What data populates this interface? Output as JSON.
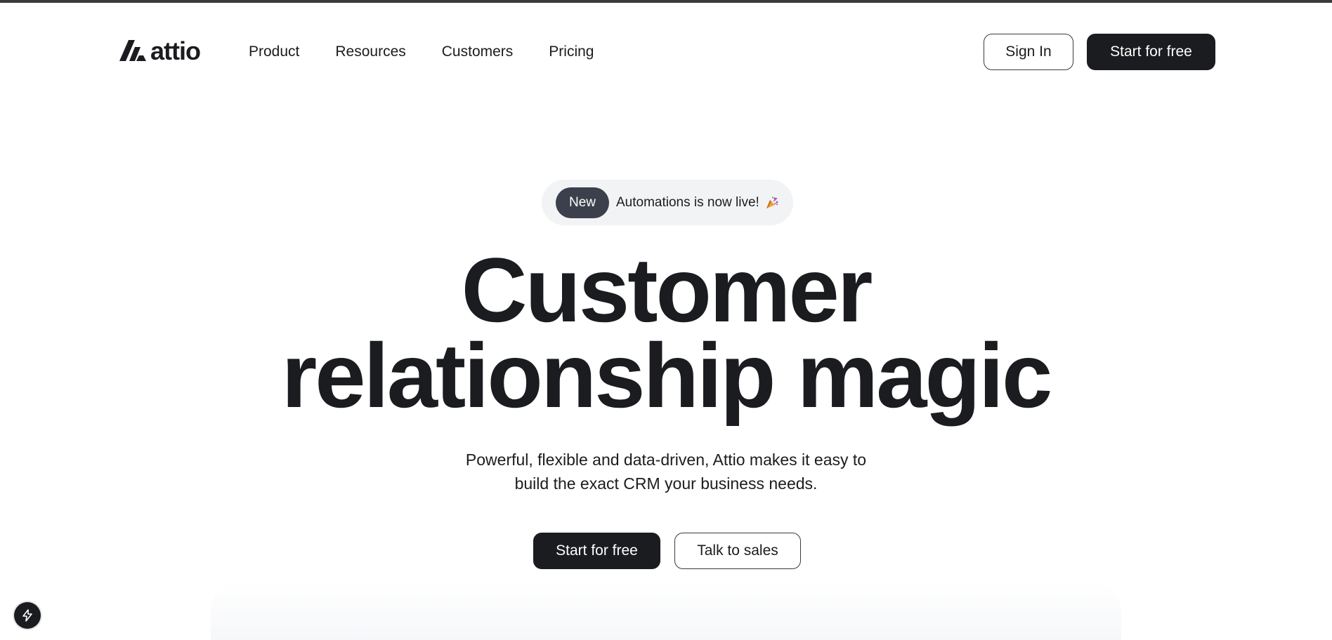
{
  "brand": {
    "name": "attio"
  },
  "nav": {
    "links": [
      "Product",
      "Resources",
      "Customers",
      "Pricing"
    ],
    "sign_in": "Sign In",
    "start_free": "Start for free"
  },
  "announcement": {
    "badge": "New",
    "text": "Automations is now live!",
    "emoji_icon": "party-popper-icon"
  },
  "hero": {
    "title_line1": "Customer",
    "title_line2": "relationship magic",
    "subtitle_line1": "Powerful, flexible and data-driven, Attio makes it easy to",
    "subtitle_line2": "build the exact CRM your business needs.",
    "primary_cta": "Start for free",
    "secondary_cta": "Talk to sales"
  },
  "colors": {
    "text": "#1b1c1f",
    "button_dark": "#1b1c1f",
    "badge_bg": "#3c404c",
    "pill_bg": "#f2f3f5"
  }
}
